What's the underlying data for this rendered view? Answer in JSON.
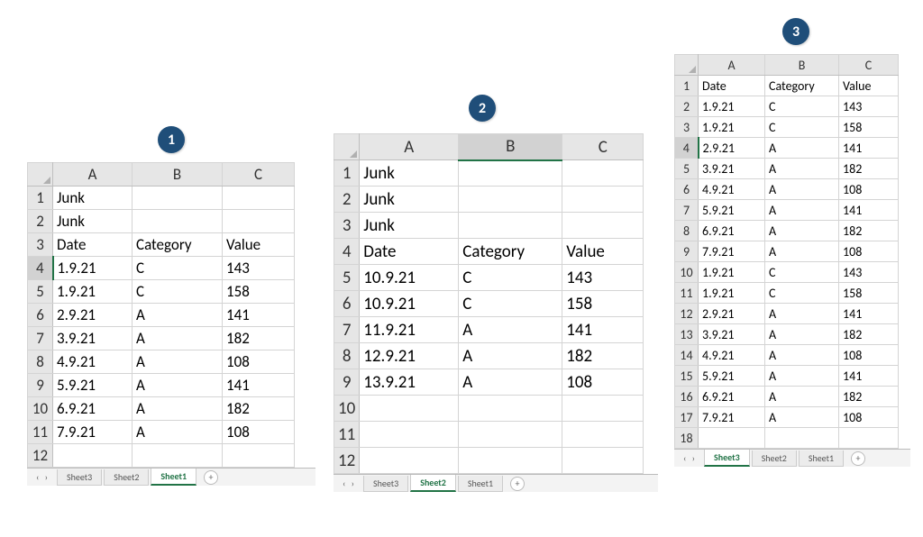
{
  "badges": {
    "one": "1",
    "two": "2",
    "three": "3"
  },
  "junk": "Junk",
  "headers": {
    "date": "Date",
    "category": "Category",
    "value": "Value"
  },
  "cols": {
    "A": "A",
    "B": "B",
    "C": "C"
  },
  "tabs": {
    "s1": "Sheet1",
    "s2": "Sheet2",
    "s3": "Sheet3",
    "add": "+",
    "nav": "‹ ›"
  },
  "wb1": {
    "junkRows": 2,
    "rows": [
      {
        "date": "1.9.21",
        "category": "C",
        "value": 143
      },
      {
        "date": "1.9.21",
        "category": "C",
        "value": 158
      },
      {
        "date": "2.9.21",
        "category": "A",
        "value": 141
      },
      {
        "date": "3.9.21",
        "category": "A",
        "value": 182
      },
      {
        "date": "4.9.21",
        "category": "A",
        "value": 108
      },
      {
        "date": "5.9.21",
        "category": "A",
        "value": 141
      },
      {
        "date": "6.9.21",
        "category": "A",
        "value": 182
      },
      {
        "date": "7.9.21",
        "category": "A",
        "value": 108
      }
    ],
    "emptyAfter": 1,
    "activeTab": "Sheet1",
    "selectedRow": 4
  },
  "wb2": {
    "junkRows": 3,
    "rows": [
      {
        "date": "10.9.21",
        "category": "C",
        "value": 143
      },
      {
        "date": "10.9.21",
        "category": "C",
        "value": 158
      },
      {
        "date": "11.9.21",
        "category": "A",
        "value": 141
      },
      {
        "date": "12.9.21",
        "category": "A",
        "value": 182
      },
      {
        "date": "13.9.21",
        "category": "A",
        "value": 108
      }
    ],
    "emptyAfter": 3,
    "activeTab": "Sheet2",
    "selectedCol": "B"
  },
  "wb3": {
    "junkRows": 0,
    "rows": [
      {
        "date": "1.9.21",
        "category": "C",
        "value": 143
      },
      {
        "date": "1.9.21",
        "category": "C",
        "value": 158
      },
      {
        "date": "2.9.21",
        "category": "A",
        "value": 141
      },
      {
        "date": "3.9.21",
        "category": "A",
        "value": 182
      },
      {
        "date": "4.9.21",
        "category": "A",
        "value": 108
      },
      {
        "date": "5.9.21",
        "category": "A",
        "value": 141
      },
      {
        "date": "6.9.21",
        "category": "A",
        "value": 182
      },
      {
        "date": "7.9.21",
        "category": "A",
        "value": 108
      },
      {
        "date": "1.9.21",
        "category": "C",
        "value": 143
      },
      {
        "date": "1.9.21",
        "category": "C",
        "value": 158
      },
      {
        "date": "2.9.21",
        "category": "A",
        "value": 141
      },
      {
        "date": "3.9.21",
        "category": "A",
        "value": 182
      },
      {
        "date": "4.9.21",
        "category": "A",
        "value": 108
      },
      {
        "date": "5.9.21",
        "category": "A",
        "value": 141
      },
      {
        "date": "6.9.21",
        "category": "A",
        "value": 182
      },
      {
        "date": "7.9.21",
        "category": "A",
        "value": 108
      }
    ],
    "emptyAfter": 1,
    "activeTab": "Sheet3",
    "selectedRow": 4
  }
}
